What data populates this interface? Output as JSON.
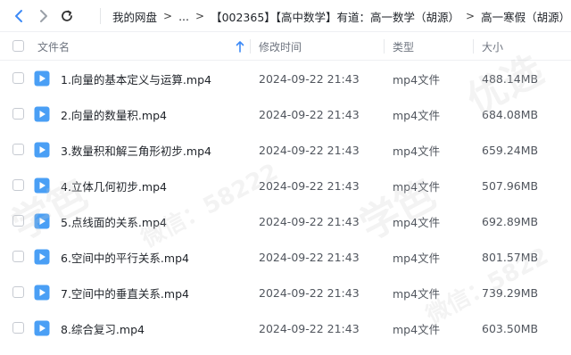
{
  "toolbar": {
    "back_icon": "chevron-left-icon",
    "forward_icon": "chevron-right-icon",
    "refresh_icon": "refresh-icon"
  },
  "breadcrumb": {
    "root": "我的网盘",
    "ellipsis": "...",
    "folder1": "【002365】【高中数学】有道：高一数学（胡源）",
    "folder2": "高一寒假（胡源）",
    "arrow": ">"
  },
  "columns": {
    "name": "文件名",
    "modified": "修改时间",
    "type": "类型",
    "size": "大小"
  },
  "files": [
    {
      "name": "1.向量的基本定义与运算.mp4",
      "modified": "2024-09-22 21:43",
      "type": "mp4文件",
      "size": "488.14MB"
    },
    {
      "name": "2.向量的数量积.mp4",
      "modified": "2024-09-22 21:43",
      "type": "mp4文件",
      "size": "684.08MB"
    },
    {
      "name": "3.数量积和解三角形初步.mp4",
      "modified": "2024-09-22 21:43",
      "type": "mp4文件",
      "size": "659.24MB"
    },
    {
      "name": "4.立体几何初步.mp4",
      "modified": "2024-09-22 21:43",
      "type": "mp4文件",
      "size": "507.96MB"
    },
    {
      "name": "5.点线面的关系.mp4",
      "modified": "2024-09-22 21:43",
      "type": "mp4文件",
      "size": "692.89MB"
    },
    {
      "name": "6.空间中的平行关系.mp4",
      "modified": "2024-09-22 21:43",
      "type": "mp4文件",
      "size": "801.57MB"
    },
    {
      "name": "7.空间中的垂直关系.mp4",
      "modified": "2024-09-22 21:43",
      "type": "mp4文件",
      "size": "739.29MB"
    },
    {
      "name": "8.综合复习.mp4",
      "modified": "2024-09-22 21:43",
      "type": "mp4文件",
      "size": "603.50MB"
    }
  ],
  "watermark": {
    "text1": "学笆",
    "text2": "微信：58222",
    "text3": "学笆",
    "text4": "微信：5822",
    "text5": "优选"
  },
  "colors": {
    "accent": "#3d8af7",
    "icon_blue": "#4a9ff5"
  }
}
